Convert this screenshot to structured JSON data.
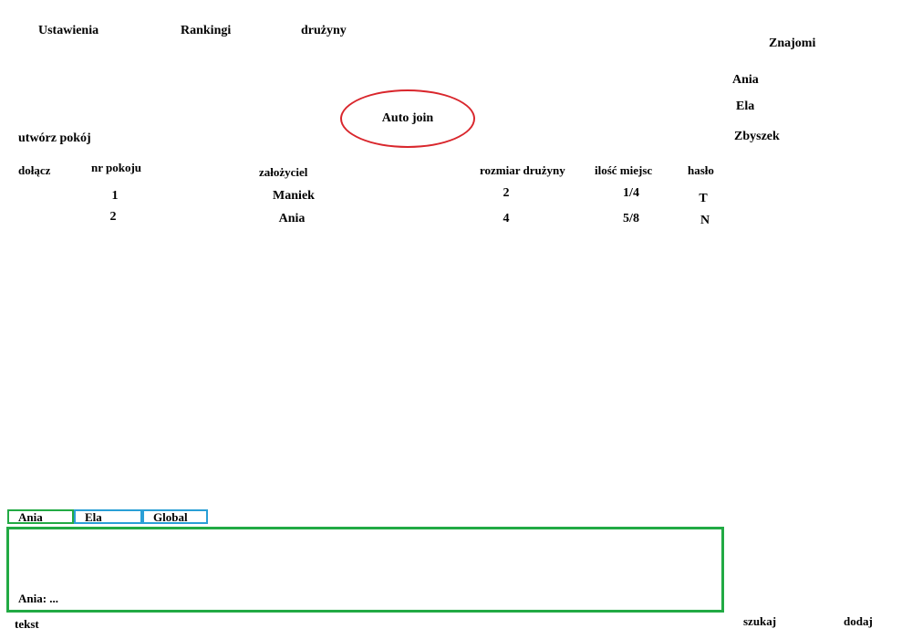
{
  "nav": {
    "settings": "Ustawienia",
    "rankings": "Rankingi",
    "teams": "drużyny"
  },
  "friends": {
    "title": "Znajomi",
    "items": [
      "Ania",
      "Ela",
      "Zbyszek"
    ]
  },
  "auto_join_label": "Auto join",
  "create_room_label": "utwórz pokój",
  "rooms_table": {
    "columns": [
      "dołącz",
      "nr pokoju",
      "założyciel",
      "rozmiar drużyny",
      "ilość miejsc",
      "hasło"
    ],
    "rows": [
      {
        "number": "1",
        "founder": "Maniek",
        "team_size": "2",
        "slots": "1/4",
        "password": "T"
      },
      {
        "number": "2",
        "founder": "Ania",
        "team_size": "4",
        "slots": "5/8",
        "password": "N"
      }
    ]
  },
  "chat": {
    "tabs": [
      "Ania",
      "Ela",
      "Global"
    ],
    "active_tab": "Ania",
    "messages": [
      "Ania: ..."
    ],
    "input_placeholder": "tekst",
    "search_label": "szukaj",
    "add_label": "dodaj"
  },
  "colors": {
    "auto_join_border": "#d9262c",
    "active_tab_border": "#22aa44",
    "inactive_tab_border": "#2a9fd6",
    "chat_box_border": "#22aa44"
  }
}
